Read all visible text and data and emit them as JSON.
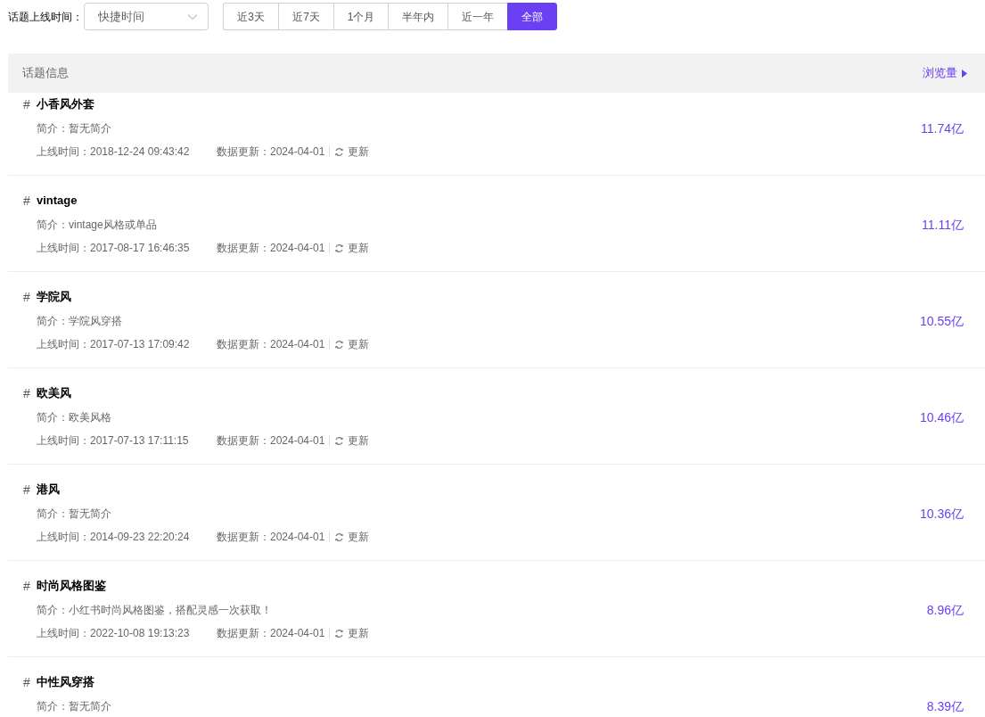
{
  "filter": {
    "label": "话题上线时间：",
    "select": {
      "placeholder": "快捷时间"
    },
    "ranges": [
      {
        "label": "近3天",
        "selected": false
      },
      {
        "label": "近7天",
        "selected": false
      },
      {
        "label": "1个月",
        "selected": false
      },
      {
        "label": "半年内",
        "selected": false
      },
      {
        "label": "近一年",
        "selected": false
      },
      {
        "label": "全部",
        "selected": true
      }
    ]
  },
  "table": {
    "columns": [
      "话题信息",
      "浏览量"
    ],
    "rows": [
      {
        "hash": "#",
        "title": "小香风外套",
        "intro": "简介：暂无简介",
        "online": "上线时间：2018-12-24 09:43:42",
        "updated": "数据更新：2024-04-01",
        "refresh": "更新",
        "views": "11.74亿"
      },
      {
        "hash": "#",
        "title": "vintage",
        "intro": "简介：vintage风格或单品",
        "online": "上线时间：2017-08-17 16:46:35",
        "updated": "数据更新：2024-04-01",
        "refresh": "更新",
        "views": "11.11亿"
      },
      {
        "hash": "#",
        "title": "学院风",
        "intro": "简介：学院风穿搭",
        "online": "上线时间：2017-07-13 17:09:42",
        "updated": "数据更新：2024-04-01",
        "refresh": "更新",
        "views": "10.55亿"
      },
      {
        "hash": "#",
        "title": "欧美风",
        "intro": "简介：欧美风格",
        "online": "上线时间：2017-07-13 17:11:15",
        "updated": "数据更新：2024-04-01",
        "refresh": "更新",
        "views": "10.46亿"
      },
      {
        "hash": "#",
        "title": "港风",
        "intro": "简介：暂无简介",
        "online": "上线时间：2014-09-23 22:20:24",
        "updated": "数据更新：2024-04-01",
        "refresh": "更新",
        "views": "10.36亿"
      },
      {
        "hash": "#",
        "title": "时尚风格图鉴",
        "intro": "简介：小红书时尚风格图鉴，搭配灵感一次获取！",
        "online": "上线时间：2022-10-08 19:13:23",
        "updated": "数据更新：2024-04-01",
        "refresh": "更新",
        "views": "8.96亿"
      },
      {
        "hash": "#",
        "title": "中性风穿搭",
        "intro": "简介：暂无简介",
        "views": "8.39亿"
      }
    ]
  }
}
